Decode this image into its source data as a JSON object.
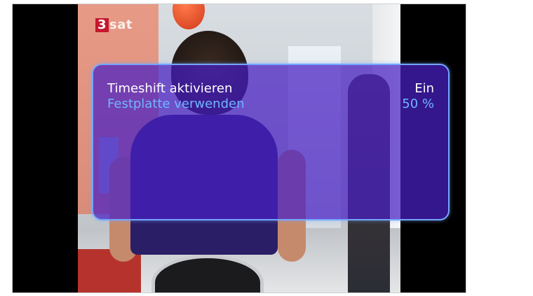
{
  "channel_logo": {
    "number": "3",
    "name": "sat"
  },
  "timeshift_menu": {
    "items": [
      {
        "label": "Timeshift aktivieren",
        "value": "Ein"
      },
      {
        "label": "Festplatte verwenden",
        "value": "50 %"
      }
    ]
  },
  "colors": {
    "panel_fill": "#481EC4",
    "panel_border": "#74A6FF",
    "active_text": "#FFFFFF",
    "inactive_text": "#6FB6FF",
    "logo_red": "#C5182C"
  }
}
